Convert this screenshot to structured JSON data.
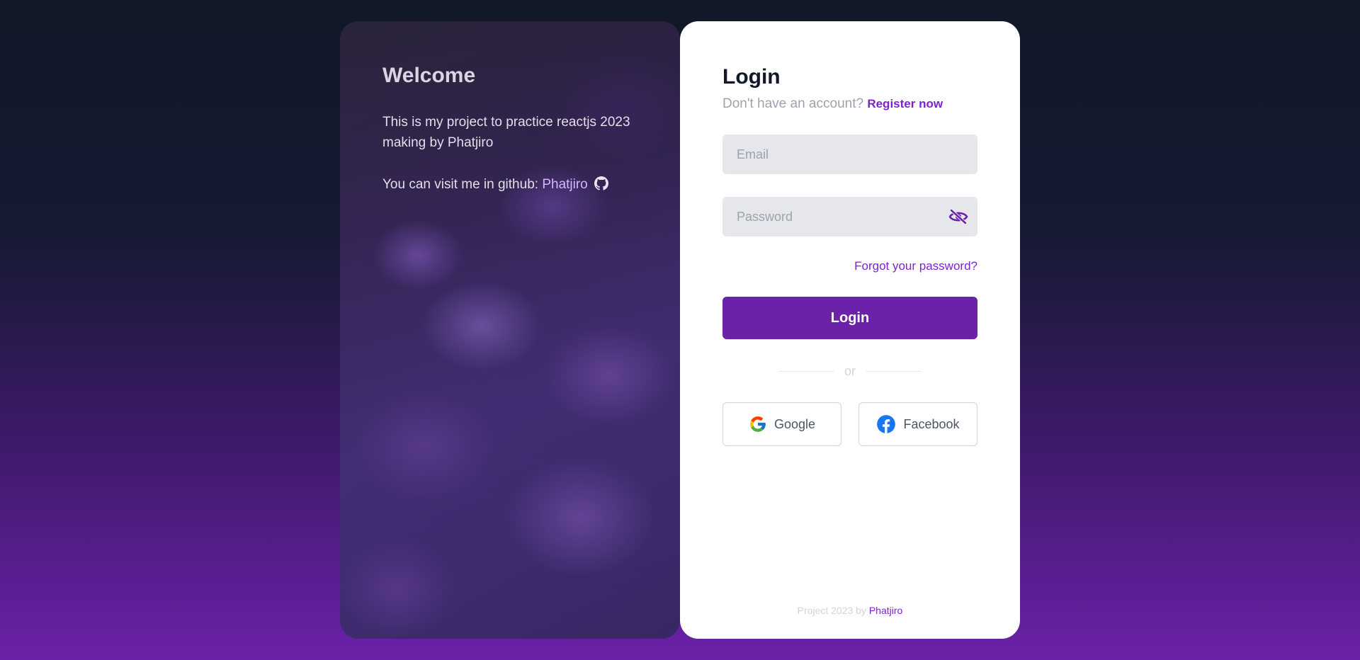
{
  "hero": {
    "title": "Welcome",
    "description": "This is my project to practice reactjs 2023 making by Phatjiro",
    "github_prefix": "You can visit me in github: ",
    "github_link": "Phatjiro"
  },
  "login": {
    "title": "Login",
    "no_account_text": "Don't have an account?",
    "register_link": "Register now",
    "email_placeholder": "Email",
    "password_placeholder": "Password",
    "forgot_link": "Forgot your password?",
    "submit_label": "Login",
    "divider_text": "or",
    "google_label": "Google",
    "facebook_label": "Facebook"
  },
  "footer": {
    "prefix": "Project 2023 by ",
    "link": "Phatjiro"
  },
  "icons": {
    "github": "github-icon",
    "eye_off": "eye-off-icon",
    "google": "google-icon",
    "facebook": "facebook-icon"
  },
  "colors": {
    "accent": "#6b21a8",
    "link": "#7e22ce",
    "input_bg": "#e5e7eb"
  }
}
